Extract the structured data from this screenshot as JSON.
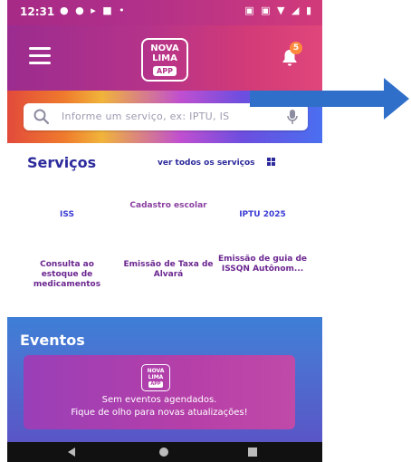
{
  "status_bar": {
    "time": "12:31",
    "left_icons": "● ● ▸ ■ •",
    "right_icons": "▣ ▣ ▼ ◢ ▮"
  },
  "header": {
    "logo_line1": "NOVA",
    "logo_line2": "LIMA",
    "logo_app": "APP",
    "notification_count": "5"
  },
  "search": {
    "placeholder": "Informe um serviço, ex: IPTU, IS"
  },
  "services": {
    "title": "Serviços",
    "see_all": "ver todos os serviços",
    "items": [
      {
        "label": "ISS"
      },
      {
        "label": "Cadastro escolar"
      },
      {
        "label": "IPTU 2025"
      },
      {
        "label": "Consulta ao estoque de medicamentos"
      },
      {
        "label": "Emissão de Taxa de Alvará"
      },
      {
        "label": "Emissão de guia de ISSQN Autônom..."
      }
    ]
  },
  "events": {
    "title": "Eventos",
    "logo_line1": "NOVA",
    "logo_line2": "LIMA",
    "logo_app": "APP",
    "empty_line1": "Sem eventos agendados.",
    "empty_line2": "Fique de olho para novas atualizações!"
  },
  "icons": {
    "menu": "menu-icon",
    "bell": "bell-icon",
    "search": "search-icon",
    "mic": "mic-icon",
    "grid": "grid-icon",
    "back": "back-icon",
    "home": "home-icon",
    "recents": "recents-icon"
  },
  "colors": {
    "primary_dark": "#2c2a9c",
    "app_bar": "#b5338a",
    "events_bg": "#4a74d2",
    "arrow": "#2f6fc9"
  }
}
